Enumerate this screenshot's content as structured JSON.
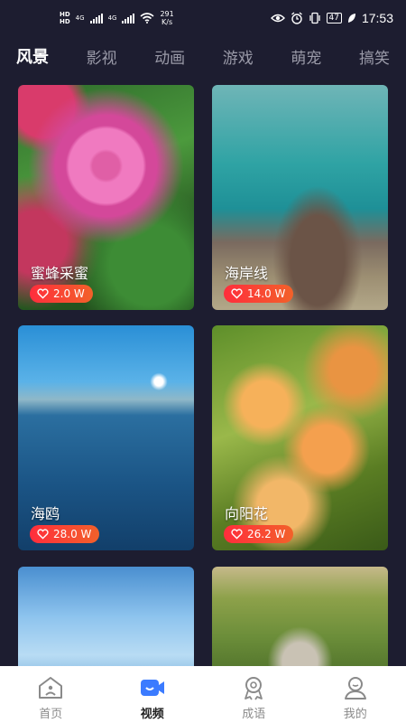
{
  "status_bar": {
    "network_rate": "291",
    "network_rate_unit": "K/s",
    "battery_level": "47",
    "time": "17:53",
    "hd_label": "HD",
    "signal_label": "4G"
  },
  "tabs": [
    {
      "label": "风景",
      "active": true
    },
    {
      "label": "影视",
      "active": false
    },
    {
      "label": "动画",
      "active": false
    },
    {
      "label": "游戏",
      "active": false
    },
    {
      "label": "萌宠",
      "active": false
    },
    {
      "label": "搞笑",
      "active": false
    }
  ],
  "cards": [
    {
      "title": "蜜蜂采蜜",
      "likes": "2.0 W"
    },
    {
      "title": "海岸线",
      "likes": "14.0 W"
    },
    {
      "title": "海鸥",
      "likes": "28.0 W"
    },
    {
      "title": "向阳花",
      "likes": "26.2 W"
    }
  ],
  "bottom_nav": [
    {
      "label": "首页",
      "icon": "home-icon",
      "active": false
    },
    {
      "label": "视频",
      "icon": "video-icon",
      "active": true
    },
    {
      "label": "成语",
      "icon": "badge-icon",
      "active": false
    },
    {
      "label": "我的",
      "icon": "profile-icon",
      "active": false
    }
  ],
  "colors": {
    "background": "#1d1d30",
    "like_badge": "#ff2d3c",
    "nav_active_accent": "#3b7bff"
  }
}
